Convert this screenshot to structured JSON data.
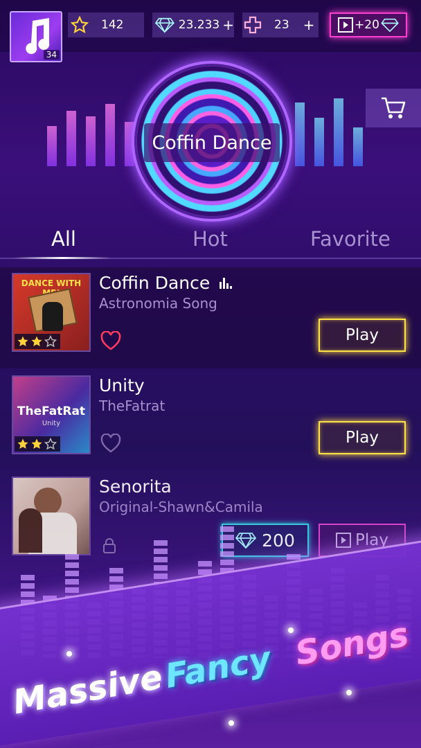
{
  "topbar": {
    "level": "34",
    "stars": "142",
    "gems": "23.233",
    "gems_plus": "+",
    "hearts": "23",
    "hearts_plus": "+",
    "ad_reward": "+20"
  },
  "hero": {
    "current_song": "Coffin Dance"
  },
  "tabs": [
    {
      "label": "All",
      "active": true
    },
    {
      "label": "Hot",
      "active": false
    },
    {
      "label": "Favorite",
      "active": false
    }
  ],
  "songs": [
    {
      "title": "Coffin Dance",
      "artist": "Astronomia Song",
      "cover_text": "DANCE WITH ME!",
      "stars_earned": 2,
      "stars_total": 3,
      "favorited": true,
      "playing": true,
      "action": "Play"
    },
    {
      "title": "Unity",
      "artist": "TheFatrat",
      "cover_text": "TheFatRat",
      "cover_subtext": "Unity",
      "stars_earned": 2,
      "stars_total": 3,
      "favorited": false,
      "playing": false,
      "action": "Play"
    },
    {
      "title": "Senorita",
      "artist": "Original-Shawn&Camila",
      "locked": true,
      "price": "200",
      "action": "Play"
    }
  ],
  "promo": {
    "word1": "Massive",
    "word2": "Fancy",
    "word3": "Songs"
  },
  "colors": {
    "play_border": "#ffe14a",
    "buy_border": "#3ad9e8",
    "locked_play_border": "#e24ad0",
    "ad_border": "#ff3fd0",
    "heart_active": "#ff3b5c",
    "star_gold": "#ffd23a"
  },
  "icons": [
    "music-note-icon",
    "star-icon",
    "diamond-icon",
    "heart-cross-icon",
    "video-icon",
    "cart-icon",
    "heart-icon",
    "lock-icon",
    "equalizer-icon"
  ]
}
